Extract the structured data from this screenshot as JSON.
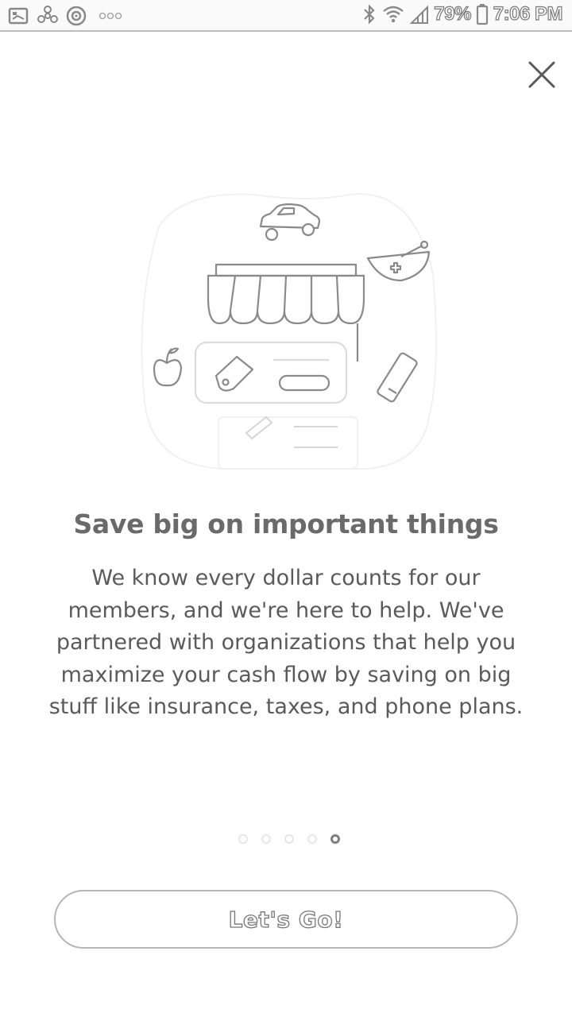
{
  "status_bar": {
    "battery_percent": "79%",
    "time": "7:06 PM",
    "icons": [
      "image-icon",
      "pinwheel-icon",
      "target-icon",
      "more-dots-icon",
      "bluetooth-icon",
      "wifi-icon",
      "signal-icon",
      "battery-icon"
    ]
  },
  "close": {
    "icon": "close-icon"
  },
  "illustration": {
    "icons": [
      "car-icon",
      "storefront-icon",
      "mortar-pestle-icon",
      "apple-icon",
      "price-tag-icon",
      "phone-icon"
    ]
  },
  "content": {
    "headline": "Save big on important things",
    "body": "We know every dollar counts for our members, and we're here to help. We've partnered with organizations that help you maximize your cash flow by saving on big stuff like insurance, taxes, and phone plans."
  },
  "pager": {
    "total": 5,
    "active_index": 4
  },
  "cta": {
    "label": "Let's Go!"
  },
  "colors": {
    "text": "#5a5a5a",
    "headline": "#6a6a6a",
    "outline": "#b5b5b5",
    "background": "#ffffff"
  }
}
